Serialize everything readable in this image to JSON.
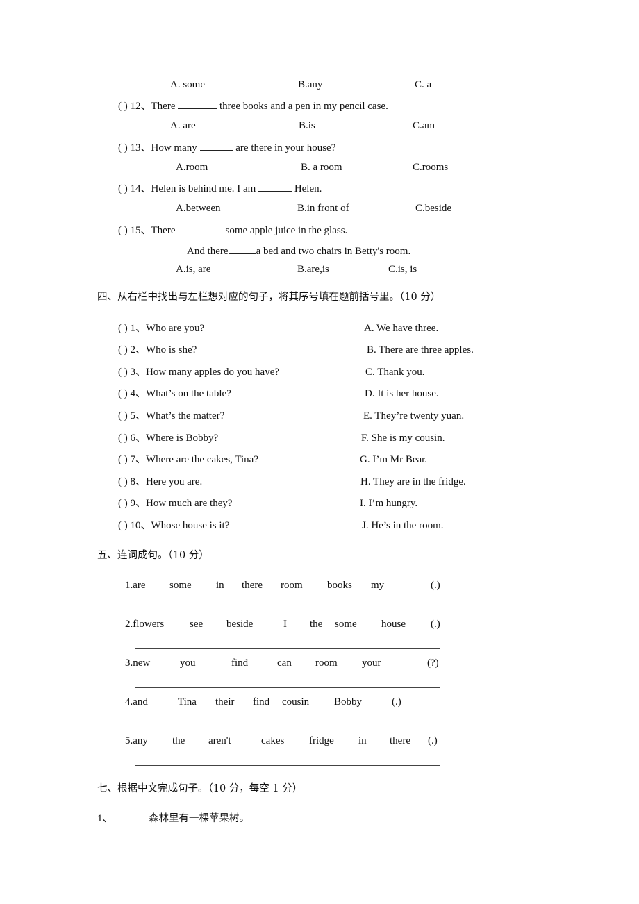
{
  "section3_continued": {
    "q11_options": [
      "A. some",
      "B.any",
      "C. a"
    ],
    "questions": [
      {
        "paren": "(      )",
        "number": "12、",
        "before": "There",
        "after": "three books and a pen in my pencil case.",
        "options": [
          "A. are",
          "B.is",
          "C.am"
        ]
      },
      {
        "paren": "(      )",
        "number": "13、",
        "before": "How many",
        "after": "are there in your house?",
        "options": [
          "A.room",
          "B. a room",
          "C.rooms"
        ]
      },
      {
        "paren": "(      )",
        "number": "14、",
        "before": "Helen is behind me. I am",
        "after": "Helen.",
        "options": [
          "A.between",
          "B.in front of",
          "C.beside"
        ]
      },
      {
        "paren": "(      )",
        "number": "15、",
        "before": "There",
        "after": "some apple juice in the glass.",
        "line2_before": "And there",
        "line2_after": "a bed and two chairs in Betty's room.",
        "options": [
          "A.is, are",
          "B.are,is",
          "C.is, is"
        ]
      }
    ]
  },
  "section4": {
    "heading": "四、从右栏中找出与左栏想对应的句子，将其序号填在题前括号里。（10 分）",
    "left": [
      "(      ) 1、Who are you?",
      "(      ) 2、Who is she?",
      "(      ) 3、How many apples do you have?",
      "(      ) 4、What’s on the table?",
      "(      ) 5、What’s the matter?",
      "(      ) 6、Where is Bobby?",
      "(      ) 7、Where are the cakes, Tina?",
      "(      ) 8、Here you are.",
      "(      ) 9、How much are they?",
      "(      ) 10、Whose house is it?"
    ],
    "right": [
      "A. We have three.",
      "B. There are three apples.",
      "C. Thank you.",
      "D. It is her house.",
      "E. They’re twenty yuan.",
      "F. She is my cousin.",
      "G. I’m Mr Bear.",
      "H. They are in the fridge.",
      "I. I’m hungry.",
      "J. He’s in the room."
    ]
  },
  "section5": {
    "heading": "五、连词成句。（10 分）",
    "items": [
      {
        "words": [
          "1.are",
          "some",
          "in",
          "there",
          "room",
          "books",
          "my"
        ],
        "punct": "(.)"
      },
      {
        "words": [
          "2.flowers",
          "see",
          "beside",
          "I",
          "the",
          "some",
          "house"
        ],
        "punct": "(.)"
      },
      {
        "words": [
          "3.new",
          "you",
          "find",
          "can",
          "room",
          "your"
        ],
        "punct": "(?)"
      },
      {
        "words": [
          "4.and",
          "Tina",
          "their",
          "find",
          "cousin",
          "Bobby"
        ],
        "punct": "(.)"
      },
      {
        "words": [
          "5.any",
          "the",
          "aren't",
          "cakes",
          "fridge",
          "in",
          "there"
        ],
        "punct": "(.)"
      }
    ]
  },
  "section7": {
    "heading": "七、根据中文完成句子。（10 分，每空 1 分）",
    "item1_number": "1、",
    "item1_text": "森林里有一棵苹果树。"
  }
}
